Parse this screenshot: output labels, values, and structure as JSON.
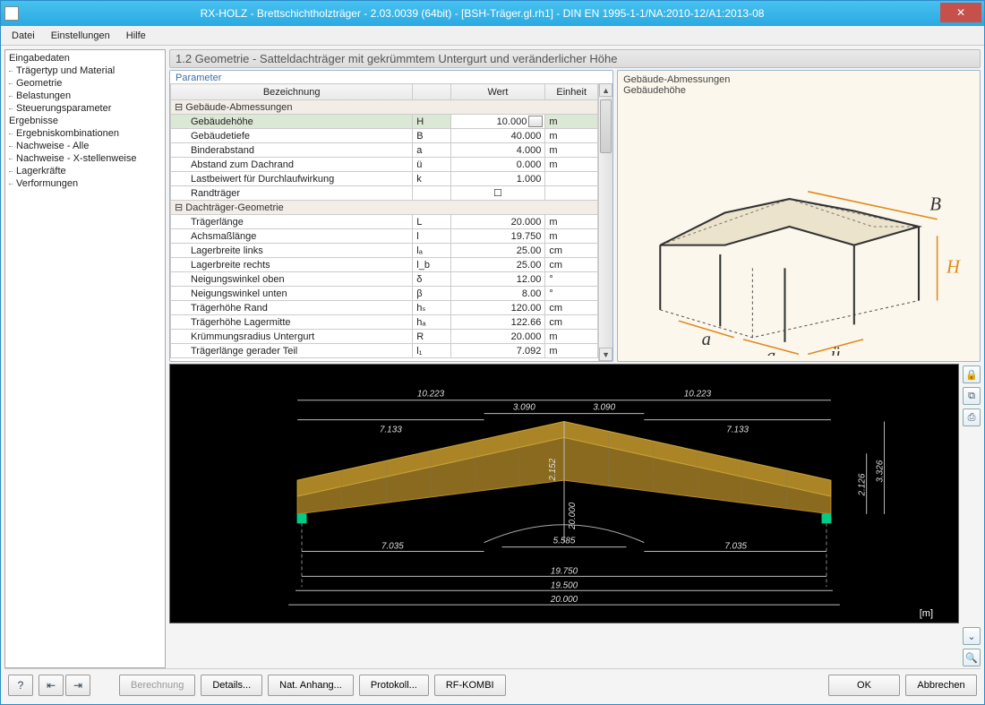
{
  "window": {
    "title": "RX-HOLZ - Brettschichtholzträger - 2.03.0039 (64bit) - [BSH-Träger.gl.rh1] - DIN EN 1995-1-1/NA:2010-12/A1:2013-08"
  },
  "menu": {
    "file": "Datei",
    "settings": "Einstellungen",
    "help": "Hilfe"
  },
  "nav": {
    "group1_title": "Eingabedaten",
    "group1": [
      "Trägertyp und Material",
      "Geometrie",
      "Belastungen",
      "Steuerungsparameter"
    ],
    "group2_title": "Ergebnisse",
    "group2": [
      "Ergebniskombinationen",
      "Nachweise - Alle",
      "Nachweise - X-stellenweise",
      "Lagerkräfte",
      "Verformungen"
    ]
  },
  "section_title": "1.2 Geometrie  -  Satteldachträger mit gekrümmtem Untergurt und veränderlicher Höhe",
  "param_legend": "Parameter",
  "headers": {
    "bez": "Bezeichnung",
    "wert": "Wert",
    "einheit": "Einheit"
  },
  "groups": {
    "g1": "Gebäude-Abmessungen",
    "g2": "Dachträger-Geometrie"
  },
  "rows_g1": [
    {
      "label": "Gebäudehöhe",
      "sym": "H",
      "val": "10.000",
      "unit": "m",
      "sel": true
    },
    {
      "label": "Gebäudetiefe",
      "sym": "B",
      "val": "40.000",
      "unit": "m"
    },
    {
      "label": "Binderabstand",
      "sym": "a",
      "val": "4.000",
      "unit": "m"
    },
    {
      "label": "Abstand zum Dachrand",
      "sym": "ü",
      "val": "0.000",
      "unit": "m"
    },
    {
      "label": "Lastbeiwert für Durchlaufwirkung",
      "sym": "k",
      "val": "1.000",
      "unit": ""
    },
    {
      "label": "Randträger",
      "sym": "",
      "val": "☐",
      "unit": "",
      "center": true
    }
  ],
  "rows_g2": [
    {
      "label": "Trägerlänge",
      "sym": "L",
      "val": "20.000",
      "unit": "m"
    },
    {
      "label": "Achsmaßlänge",
      "sym": "l",
      "val": "19.750",
      "unit": "m"
    },
    {
      "label": "Lagerbreite links",
      "sym": "lₐ",
      "val": "25.00",
      "unit": "cm"
    },
    {
      "label": "Lagerbreite rechts",
      "sym": "l_b",
      "val": "25.00",
      "unit": "cm"
    },
    {
      "label": "Neigungswinkel oben",
      "sym": "δ",
      "val": "12.00",
      "unit": "°"
    },
    {
      "label": "Neigungswinkel unten",
      "sym": "β",
      "val": "8.00",
      "unit": "°"
    },
    {
      "label": "Trägerhöhe Rand",
      "sym": "hₛ",
      "val": "120.00",
      "unit": "cm"
    },
    {
      "label": "Trägerhöhe Lagermitte",
      "sym": "hₐ",
      "val": "122.66",
      "unit": "cm"
    },
    {
      "label": "Krümmungsradius Untergurt",
      "sym": "R",
      "val": "20.000",
      "unit": "m"
    },
    {
      "label": "Trägerlänge gerader Teil",
      "sym": "l₁",
      "val": "7.092",
      "unit": "m"
    }
  ],
  "info": {
    "line1": "Gebäude-Abmessungen",
    "line2": "Gebäudehöhe",
    "labels": {
      "B": "B",
      "H": "H",
      "a": "a",
      "u": "ü"
    }
  },
  "drawing": {
    "unit": "[m]",
    "dims": {
      "top_l": "10.223",
      "top_r": "10.223",
      "mid_l": "7.133",
      "mid_r": "7.133",
      "apex_l": "3.090",
      "apex_r": "3.090",
      "h_apex": "2.152",
      "R": "20.000",
      "chord": "5.585",
      "low_l": "7.035",
      "low_r": "7.035",
      "span1": "19.750",
      "span2": "19.500",
      "span3": "20.000",
      "h_right1": "2.126",
      "h_right2": "3.326"
    }
  },
  "buttons": {
    "calc": "Berechnung",
    "details": "Details...",
    "nat": "Nat. Anhang...",
    "proto": "Protokoll...",
    "kombi": "RF-KOMBI",
    "ok": "OK",
    "cancel": "Abbrechen"
  }
}
